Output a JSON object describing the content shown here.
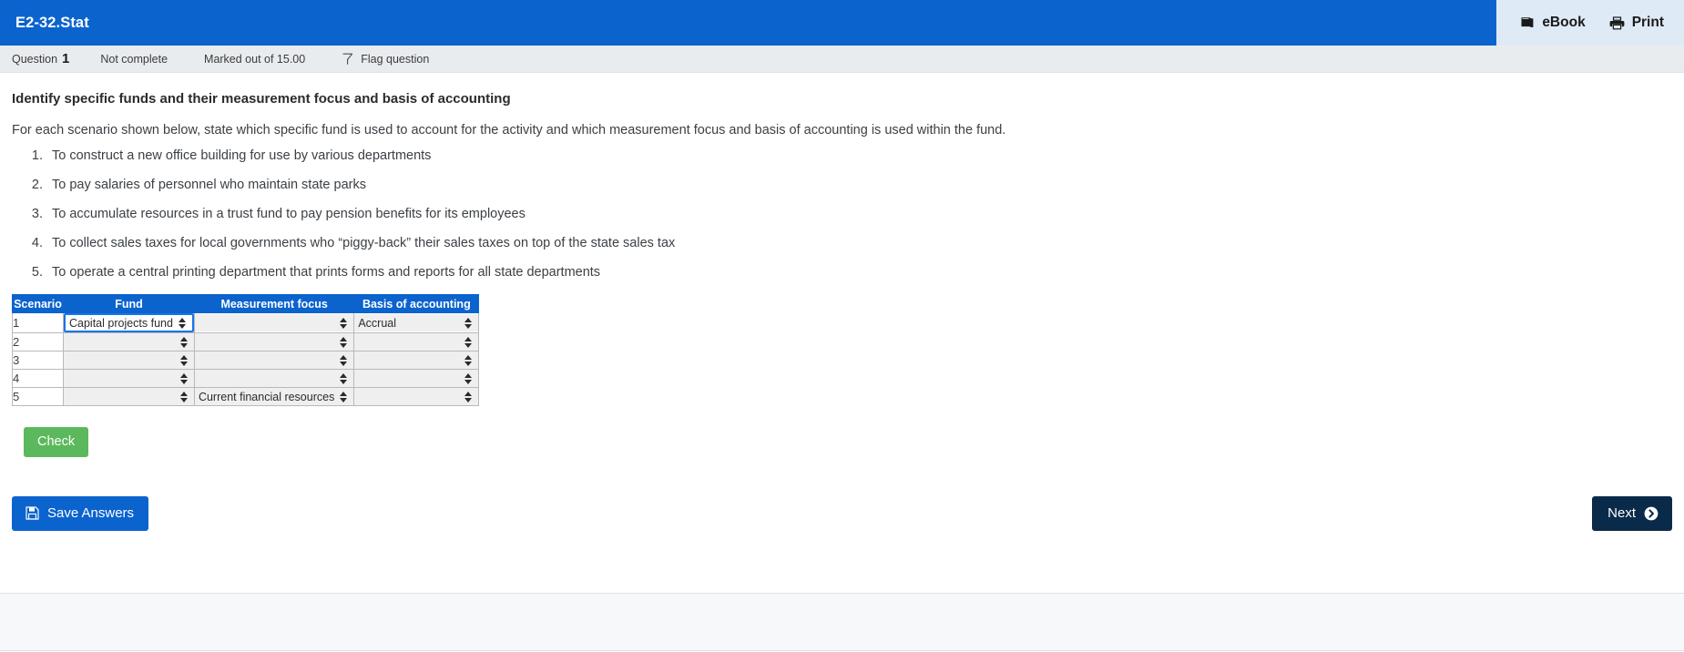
{
  "topbar": {
    "title": "E2-32.Stat",
    "actions": [
      {
        "label": "eBook",
        "icon": "book-icon"
      },
      {
        "label": "Print",
        "icon": "printer-icon"
      }
    ]
  },
  "infobar": {
    "question_word": "Question",
    "question_number": "1",
    "state": "Not complete",
    "marks": "Marked out of 15.00",
    "flag_label": "Flag question",
    "flag_icon": "flag-icon"
  },
  "question": {
    "title": "Identify specific funds and their measurement focus and basis of accounting",
    "intro": "For each scenario shown below, state which specific fund is used to account for the activity and which measurement focus and basis of accounting is used within the fund.",
    "scenarios": [
      "To construct a new office building for use by various departments",
      "To pay salaries of personnel who maintain state parks",
      "To accumulate resources in a trust fund to pay pension benefits for its employees",
      "To collect sales taxes for local governments who “piggy-back” their sales taxes on top of the state sales tax",
      "To operate a central printing department that prints forms and reports for all state departments"
    ]
  },
  "answer_table": {
    "headers": [
      "Scenario",
      "Fund",
      "Measurement focus",
      "Basis of accounting"
    ],
    "rows": [
      {
        "scenario": "1",
        "fund": "Capital projects fund",
        "focus": "",
        "basis": "Accrual"
      },
      {
        "scenario": "2",
        "fund": "",
        "focus": "",
        "basis": ""
      },
      {
        "scenario": "3",
        "fund": "",
        "focus": "",
        "basis": ""
      },
      {
        "scenario": "4",
        "fund": "",
        "focus": "",
        "basis": ""
      },
      {
        "scenario": "5",
        "fund": "",
        "focus": "Current financial resources",
        "basis": ""
      }
    ]
  },
  "buttons": {
    "check": "Check",
    "save": "Save Answers",
    "save_icon": "save-icon",
    "next": "Next",
    "next_icon": "chevron-right-circle-icon"
  },
  "colors": {
    "brand_blue": "#0b63ce",
    "header_blue": "#0b63ce",
    "check_green": "#5cb85c",
    "next_navy": "#0a2a4a",
    "infobar_gray": "#e9ecef",
    "ebook_panel": "#dfeaf7",
    "select_gray": "#efefef",
    "focus_outline": "#1a73e8"
  }
}
